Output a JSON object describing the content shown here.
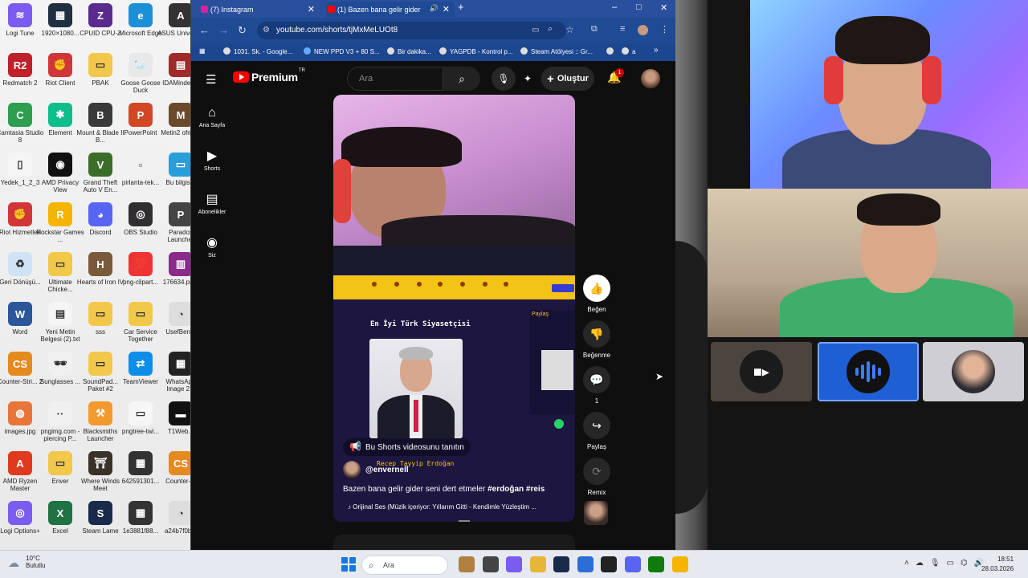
{
  "desktop": {
    "icons": [
      {
        "label": "Logi Tune",
        "color": "#7b5cf0",
        "glyph": "≋"
      },
      {
        "label": "1920×1080...",
        "color": "#203040",
        "glyph": "▦"
      },
      {
        "label": "CPUID CPU-Z",
        "color": "#5a2b8c",
        "glyph": "Z"
      },
      {
        "label": "Microsoft Edge",
        "color": "#1c8fd6",
        "glyph": "e"
      },
      {
        "label": "ASUS Univers...",
        "color": "#333333",
        "glyph": "A"
      },
      {
        "label": "Redmatch 2",
        "color": "#c0202a",
        "glyph": "R2"
      },
      {
        "label": "Riot Client",
        "color": "#d13639",
        "glyph": "✊"
      },
      {
        "label": "PBAK",
        "color": "#f2c84b",
        "glyph": "▭"
      },
      {
        "label": "Goose Goose Duck",
        "color": "#e8e8e8",
        "glyph": "🦢"
      },
      {
        "label": "IDAMindex...",
        "color": "#a02a2a",
        "glyph": "▤"
      },
      {
        "label": "Camtasia Studio 8",
        "color": "#2e9e4f",
        "glyph": "C"
      },
      {
        "label": "Element",
        "color": "#0dbd8b",
        "glyph": "✱"
      },
      {
        "label": "Mount & Blade II B...",
        "color": "#3a3a3a",
        "glyph": "B"
      },
      {
        "label": "PowerPoint",
        "color": "#d24726",
        "glyph": "P"
      },
      {
        "label": "Metin2 ofrijil...",
        "color": "#6b4a2b",
        "glyph": "M"
      },
      {
        "label": "Yedek_1_2_3",
        "color": "#f5f5f5",
        "glyph": "▯"
      },
      {
        "label": "AMD Privacy View",
        "color": "#111111",
        "glyph": "◉"
      },
      {
        "label": "Grand Theft Auto V En...",
        "color": "#3c6e2a",
        "glyph": "V"
      },
      {
        "label": "pirlanta-tek...",
        "color": "#f0f0f0",
        "glyph": "▫"
      },
      {
        "label": "Bu bilgis...",
        "color": "#2a9ed8",
        "glyph": "▭"
      },
      {
        "label": "Riot Hizmetleri",
        "color": "#d13639",
        "glyph": "✊"
      },
      {
        "label": "Rockstar Games ...",
        "color": "#f4b400",
        "glyph": "R"
      },
      {
        "label": "Discord",
        "color": "#5865f2",
        "glyph": "◕"
      },
      {
        "label": "OBS Studio",
        "color": "#302e31",
        "glyph": "◎"
      },
      {
        "label": "Paradox Launcher",
        "color": "#444444",
        "glyph": "P"
      },
      {
        "label": "Geri Dönüşü...",
        "color": "#cfe3f5",
        "glyph": "♻"
      },
      {
        "label": "Ultimate Chicke...",
        "color": "#f2c84b",
        "glyph": "▭"
      },
      {
        "label": "Hearts of Iron IV",
        "color": "#7a5a3a",
        "glyph": "H"
      },
      {
        "label": "png-clipart...",
        "color": "#e33",
        "glyph": "💯"
      },
      {
        "label": "176634.pn...",
        "color": "#8a2a8a",
        "glyph": "▥"
      },
      {
        "label": "Word",
        "color": "#2b579a",
        "glyph": "W"
      },
      {
        "label": "Yeni Metin Belgesi (2).txt",
        "color": "#f5f5f5",
        "glyph": "▤"
      },
      {
        "label": "sss",
        "color": "#f2c84b",
        "glyph": "▭"
      },
      {
        "label": "Car Service Together",
        "color": "#f2c84b",
        "glyph": "▭"
      },
      {
        "label": "UsefBen...",
        "color": "#dddddd",
        "glyph": "◔"
      },
      {
        "label": "Counter-Stri... 2",
        "color": "#e58a1f",
        "glyph": "CS"
      },
      {
        "label": "Sunglasses ...",
        "color": "#f0f0f0",
        "glyph": "🕶"
      },
      {
        "label": "SoundPad... Paket #2",
        "color": "#f2c84b",
        "glyph": "▭"
      },
      {
        "label": "TeamViewer",
        "color": "#0e8ee9",
        "glyph": "⇄"
      },
      {
        "label": "WhatsApp Image 2...",
        "color": "#222222",
        "glyph": "▦"
      },
      {
        "label": "images.jpg",
        "color": "#e9743a",
        "glyph": "◍"
      },
      {
        "label": "pngimg.com - piercing P...",
        "color": "#f0f0f0",
        "glyph": "··"
      },
      {
        "label": "Blacksmiths Launcher",
        "color": "#f29a2e",
        "glyph": "⚒"
      },
      {
        "label": "pngtree-twi...",
        "color": "#f6f6f6",
        "glyph": "▭"
      },
      {
        "label": "T1Web...",
        "color": "#111111",
        "glyph": "▬"
      },
      {
        "label": "AMD Ryzen Master",
        "color": "#e03a1e",
        "glyph": "A"
      },
      {
        "label": "Enver",
        "color": "#f2c84b",
        "glyph": "▭"
      },
      {
        "label": "Where Winds Meet",
        "color": "#3a3226",
        "glyph": "⛩"
      },
      {
        "label": "642591301...",
        "color": "#333333",
        "glyph": "▦"
      },
      {
        "label": "Counter-...",
        "color": "#e58a1f",
        "glyph": "CS"
      },
      {
        "label": "Logi Options+",
        "color": "#7b5cf0",
        "glyph": "◎"
      },
      {
        "label": "Excel",
        "color": "#1f7244",
        "glyph": "X"
      },
      {
        "label": "Steam Lame",
        "color": "#1a2a4a",
        "glyph": "S"
      },
      {
        "label": "1e3881f88...",
        "color": "#333333",
        "glyph": "▦"
      },
      {
        "label": "a24b7f0b...",
        "color": "#dddddd",
        "glyph": "◔"
      }
    ]
  },
  "browser": {
    "tabs": [
      {
        "title": "(7) Instagram",
        "favicon_color": "#d6249f",
        "active": false
      },
      {
        "title": "(1) Bazen bana gelir gider",
        "favicon_color": "#ff0000",
        "active": true
      }
    ],
    "new_tab": "+",
    "window_controls": {
      "minimize": "–",
      "maximize": "□",
      "close": "✕"
    },
    "url": "youtube.com/shorts/tjMxMeLUOt8",
    "bookmarks": [
      "1031. Sk. - Google...",
      "NEW PPD V3 + 80 S...",
      "Bir dakika...",
      "YAGPDB - Kontrol p...",
      "Steam Atölyesi :: Gr...",
      "a"
    ],
    "bookmarks_more": "»"
  },
  "youtube": {
    "logo_text": "Premium",
    "logo_region": "TR",
    "search_placeholder": "Ara",
    "create_label": "Oluştur",
    "notification_count": "1",
    "sidebar": [
      {
        "label": "Ana Sayfa",
        "icon": "home-icon",
        "glyph": "⌂"
      },
      {
        "label": "Shorts",
        "icon": "shorts-icon",
        "glyph": "▶"
      },
      {
        "label": "Abonelikler",
        "icon": "subscriptions-icon",
        "glyph": "▤"
      },
      {
        "label": "Siz",
        "icon": "you-icon",
        "glyph": "◉"
      }
    ],
    "short": {
      "promote_label": "Bu Shorts videosunu tanıtın",
      "channel": "@envernell",
      "title_plain": "Bazen bana gelir gider seni dert etmeler ",
      "title_hashtags": "#erdoğan #reis",
      "music": "Orijinal Ses (Müzik içeriyor: Yıllarım Gitti - Kendimle Yüzleştim ...",
      "panel_title": "En İyi Türk Siyasetçisi",
      "portrait_caption": "Recep Tayyip Erdoğan",
      "share_label": "Paylaş"
    },
    "actions": [
      {
        "label": "Beğen",
        "icon": "like-icon",
        "glyph": "👍"
      },
      {
        "label": "Beğenme",
        "icon": "dislike-icon",
        "glyph": "👎"
      },
      {
        "label": "1",
        "icon": "comment-icon",
        "glyph": "💬"
      },
      {
        "label": "Paylaş",
        "icon": "share-icon",
        "glyph": "↪"
      },
      {
        "label": "Remix",
        "icon": "remix-icon",
        "glyph": "⟳"
      }
    ]
  },
  "call": {
    "tiles": [
      {
        "name": "camera-tile",
        "icon": "video-camera-icon"
      },
      {
        "name": "voice-tile",
        "icon": "audio-wave-icon"
      },
      {
        "name": "avatar-tile",
        "icon": "participant-avatar"
      }
    ]
  },
  "taskbar": {
    "weather_temp": "10°C",
    "weather_desc": "Bulutlu",
    "search_placeholder": "Ara",
    "time": "18:51",
    "date": "28.03.2026",
    "apps": [
      {
        "name": "taskbar-widget",
        "color": "#b08040"
      },
      {
        "name": "taskbar-file-manager",
        "color": "#444444"
      },
      {
        "name": "taskbar-copilot",
        "color": "#7a5cf0"
      },
      {
        "name": "taskbar-explorer",
        "color": "#e8b43a"
      },
      {
        "name": "taskbar-steam",
        "color": "#1a2a4a"
      },
      {
        "name": "taskbar-store",
        "color": "#2b6fd6"
      },
      {
        "name": "taskbar-app-dark",
        "color": "#222222"
      },
      {
        "name": "taskbar-discord",
        "color": "#5865f2"
      },
      {
        "name": "taskbar-xbox",
        "color": "#107c10"
      },
      {
        "name": "taskbar-chrome",
        "color": "#f4b400"
      }
    ]
  }
}
